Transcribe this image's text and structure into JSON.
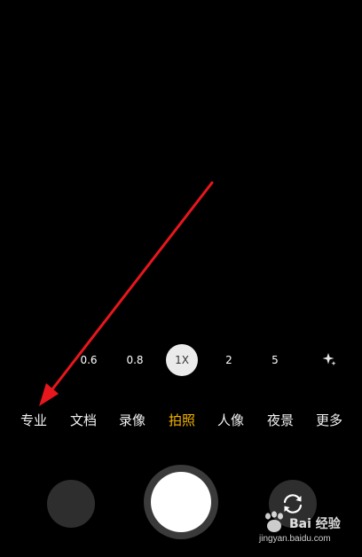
{
  "camera": {
    "zoom_levels": [
      {
        "label": "0.6"
      },
      {
        "label": "0.8"
      },
      {
        "label": "1X",
        "active": true
      },
      {
        "label": "2"
      },
      {
        "label": "5"
      }
    ],
    "zoom_ai_icon": "sparkle-icon",
    "modes": [
      {
        "label": "专业"
      },
      {
        "label": "文档"
      },
      {
        "label": "录像"
      },
      {
        "label": "拍照",
        "active": true
      },
      {
        "label": "人像"
      },
      {
        "label": "夜景"
      },
      {
        "label": "更多"
      }
    ],
    "switch_icon": "rotate-camera-icon",
    "active_color": "#f4b400"
  },
  "annotation": {
    "arrow_color": "#e8161d"
  },
  "watermark": {
    "brand": "Bai 经验",
    "url": "jingyan.baidu.com"
  }
}
